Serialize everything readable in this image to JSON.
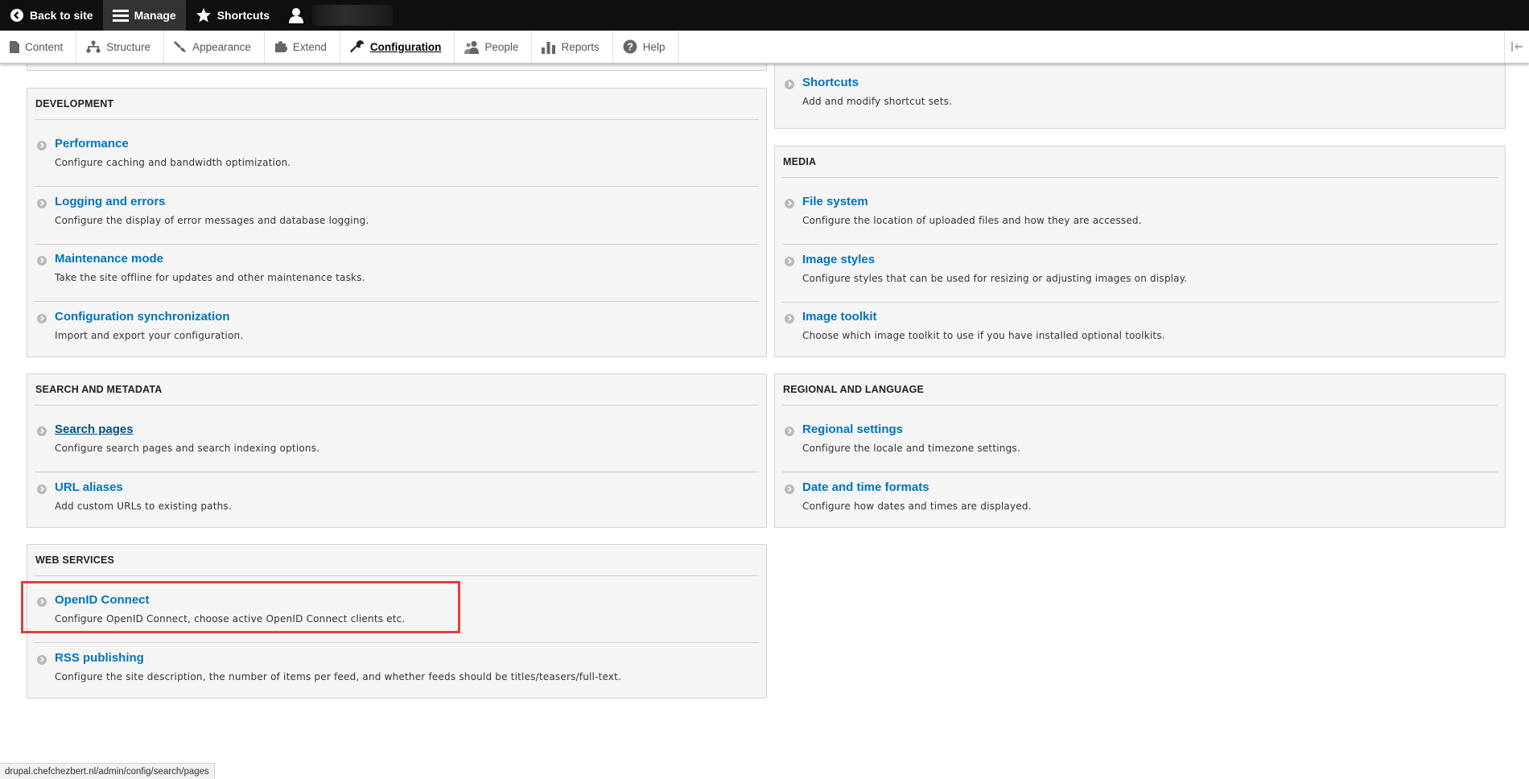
{
  "toolbar": {
    "back": "Back to site",
    "manage": "Manage",
    "shortcuts": "Shortcuts"
  },
  "tray": {
    "items": [
      "Content",
      "Structure",
      "Appearance",
      "Extend",
      "Configuration",
      "People",
      "Reports",
      "Help"
    ],
    "active": "Configuration"
  },
  "sections": {
    "shortcuts_section": {
      "items": [
        {
          "title": "Shortcuts",
          "desc": "Add and modify shortcut sets."
        }
      ]
    },
    "development": {
      "title": "DEVELOPMENT",
      "items": [
        {
          "title": "Performance",
          "desc": "Configure caching and bandwidth optimization."
        },
        {
          "title": "Logging and errors",
          "desc": "Configure the display of error messages and database logging."
        },
        {
          "title": "Maintenance mode",
          "desc": "Take the site offline for updates and other maintenance tasks."
        },
        {
          "title": "Configuration synchronization",
          "desc": "Import and export your configuration."
        }
      ]
    },
    "media": {
      "title": "MEDIA",
      "items": [
        {
          "title": "File system",
          "desc": "Configure the location of uploaded files and how they are accessed."
        },
        {
          "title": "Image styles",
          "desc": "Configure styles that can be used for resizing or adjusting images on display."
        },
        {
          "title": "Image toolkit",
          "desc": "Choose which image toolkit to use if you have installed optional toolkits."
        }
      ]
    },
    "search": {
      "title": "SEARCH AND METADATA",
      "items": [
        {
          "title": "Search pages",
          "desc": "Configure search pages and search indexing options."
        },
        {
          "title": "URL aliases",
          "desc": "Add custom URLs to existing paths."
        }
      ]
    },
    "regional": {
      "title": "REGIONAL AND LANGUAGE",
      "items": [
        {
          "title": "Regional settings",
          "desc": "Configure the locale and timezone settings."
        },
        {
          "title": "Date and time formats",
          "desc": "Configure how dates and times are displayed."
        }
      ]
    },
    "webservices": {
      "title": "WEB SERVICES",
      "items": [
        {
          "title": "OpenID Connect",
          "desc": "Configure OpenID Connect, choose active OpenID Connect clients etc."
        },
        {
          "title": "RSS publishing",
          "desc": "Configure the site description, the number of items per feed, and whether feeds should be titles/teasers/full-text."
        }
      ]
    }
  },
  "status_url": "drupal.chefchezbert.nl/admin/config/search/pages",
  "colors": {
    "link": "#0074bd",
    "highlight": "#e0403c",
    "toolbar": "#0f0f0f"
  }
}
